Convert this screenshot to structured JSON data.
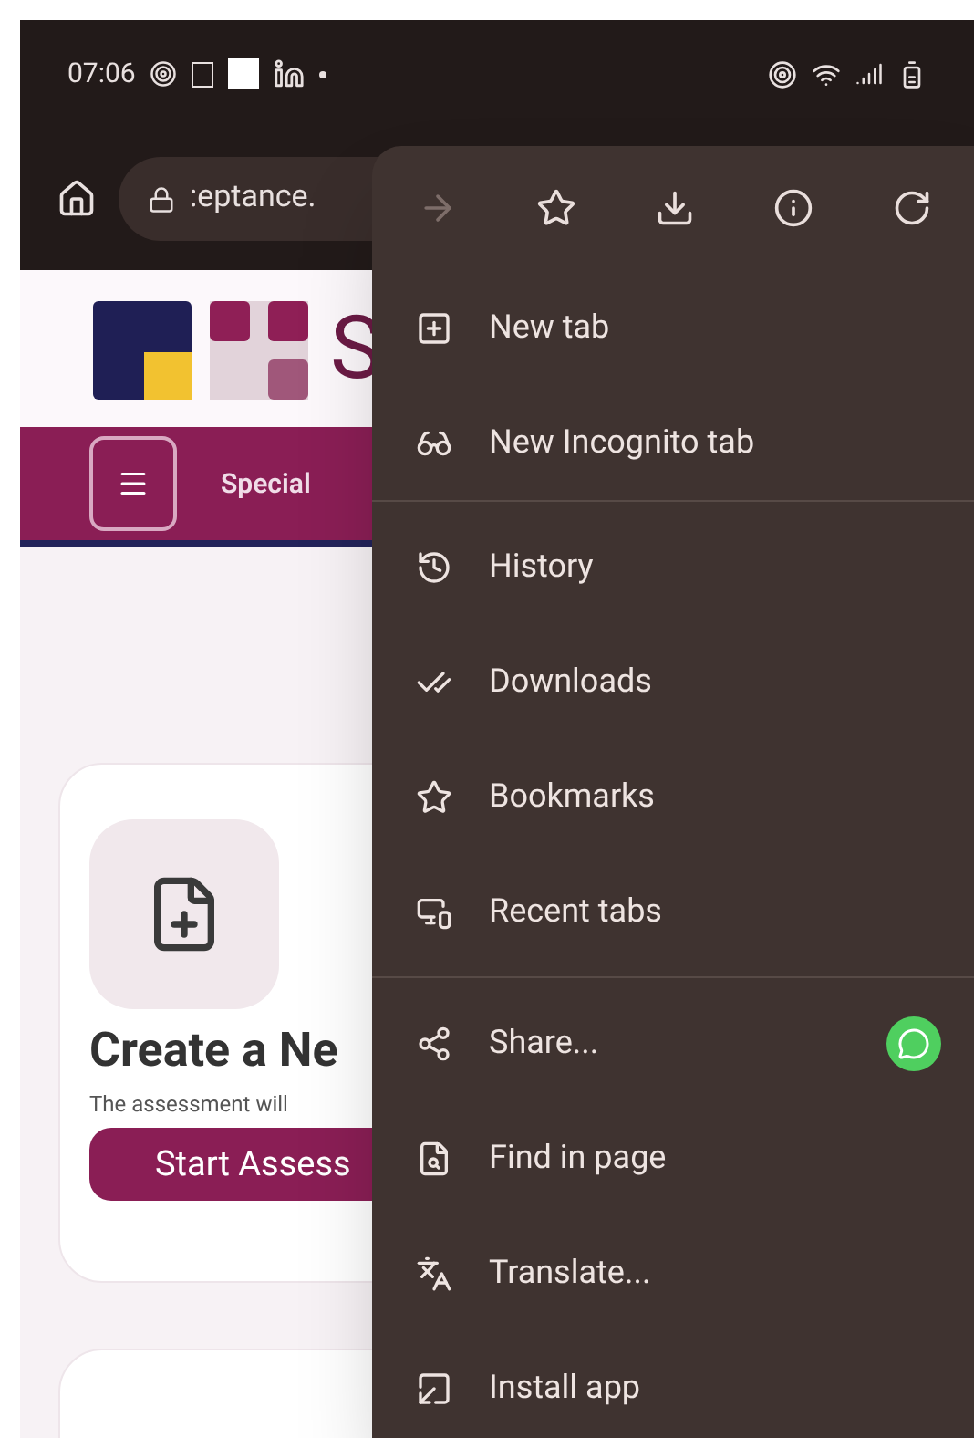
{
  "status_bar": {
    "time": "07:06"
  },
  "toolbar": {
    "url": ":eptance."
  },
  "page": {
    "logo_letter": "S",
    "nav_label": "Special",
    "card": {
      "title": "Create a Ne",
      "description": "The assessment will",
      "button": "Start Assess"
    }
  },
  "menu": {
    "actions": [
      {
        "kind": "forward",
        "disabled": true
      },
      {
        "kind": "star",
        "disabled": false
      },
      {
        "kind": "download",
        "disabled": false
      },
      {
        "kind": "info",
        "disabled": false
      },
      {
        "kind": "reload",
        "disabled": false
      }
    ],
    "sections": [
      [
        {
          "kind": "new-tab",
          "label": "New tab"
        },
        {
          "kind": "incognito",
          "label": "New Incognito tab"
        }
      ],
      [
        {
          "kind": "history",
          "label": "History"
        },
        {
          "kind": "downloads",
          "label": "Downloads"
        },
        {
          "kind": "bookmarks",
          "label": "Bookmarks"
        },
        {
          "kind": "recent",
          "label": "Recent tabs"
        }
      ],
      [
        {
          "kind": "share",
          "label": "Share...",
          "app_shortcut": true
        },
        {
          "kind": "find",
          "label": "Find in page",
          "app_shortcut": false
        },
        {
          "kind": "translate",
          "label": "Translate...",
          "app_shortcut": false
        },
        {
          "kind": "install",
          "label": "Install app",
          "app_shortcut": false
        }
      ]
    ]
  }
}
